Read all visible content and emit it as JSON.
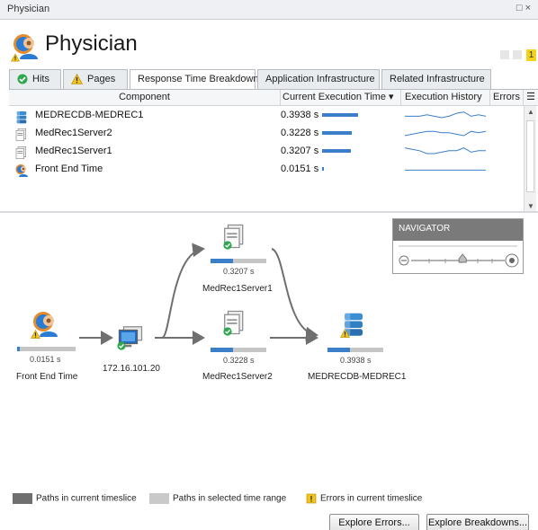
{
  "window": {
    "title": "Physician",
    "restore_icon": "restore-icon",
    "close_icon": "close-icon",
    "controls": "□ ×"
  },
  "header": {
    "title": "Physician",
    "icon": "physician-icon",
    "alert_count": "1"
  },
  "tabs": [
    {
      "label": "Hits",
      "icon": "check-circle-icon"
    },
    {
      "label": "Pages",
      "icon": "warning-icon"
    },
    {
      "label": "Response Time Breakdown",
      "active": true
    },
    {
      "label": "Application Infrastructure"
    },
    {
      "label": "Related Infrastructure"
    }
  ],
  "grid": {
    "columns": {
      "component": "Component",
      "current_execution_time": "Current Execution Time",
      "sort_indicator": "▾",
      "execution_history": "Execution History",
      "errors": "Errors"
    },
    "rows": [
      {
        "name": "MEDRECDB-MEDREC1",
        "time": "0.3938 s",
        "icon": "database-server-icon",
        "bar_fraction": 1.0,
        "history": [
          6,
          6,
          6,
          7,
          6,
          5,
          6,
          8,
          9,
          6,
          7,
          6
        ]
      },
      {
        "name": "MedRec1Server2",
        "time": "0.3228 s",
        "icon": "app-server-icon",
        "bar_fraction": 0.82,
        "history": [
          5,
          6,
          7,
          8,
          8,
          7,
          7,
          6,
          5,
          8,
          7,
          8
        ]
      },
      {
        "name": "MedRec1Server1",
        "time": "0.3207 s",
        "icon": "app-server-icon",
        "bar_fraction": 0.81,
        "history": [
          9,
          8,
          7,
          5,
          5,
          6,
          7,
          7,
          9,
          6,
          7,
          7
        ]
      },
      {
        "name": "Front End Time",
        "time": "0.0151 s",
        "icon": "physician-icon",
        "bar_fraction": 0.04,
        "history": [
          6,
          6,
          6,
          6,
          6,
          6,
          6,
          6,
          6,
          6,
          6,
          6
        ]
      }
    ]
  },
  "flow": {
    "nodes": {
      "front_end": {
        "label": "Front End Time",
        "time": "0.0151 s",
        "icon": "physician-icon",
        "fill_fraction": 0.04
      },
      "gateway": {
        "label": "172.16.101.20",
        "icon": "monitor-icon"
      },
      "server1": {
        "label": "MedRec1Server1",
        "time": "0.3207 s",
        "icon": "app-server-icon",
        "fill_fraction": 0.4
      },
      "server2": {
        "label": "MedRec1Server2",
        "time": "0.3228 s",
        "icon": "app-server-icon",
        "fill_fraction": 0.4
      },
      "database": {
        "label": "MEDRECDB-MEDREC1",
        "time": "0.3938 s",
        "icon": "database-server-icon",
        "fill_fraction": 0.4
      }
    }
  },
  "navigator": {
    "title": "NAVIGATOR",
    "zoom_level": 0.55
  },
  "legend": {
    "current": {
      "label": "Paths in current timeslice",
      "color": "#6f6f6f"
    },
    "selected": {
      "label": "Paths in selected time range",
      "color": "#c9c9c9"
    },
    "errors": {
      "label": "Errors in current timeslice",
      "color": "#f0c419"
    }
  },
  "buttons": {
    "explore_errors": "Explore Errors...",
    "explore_breakdowns": "Explore Breakdowns..."
  },
  "colors": {
    "accent": "#3c7fc9",
    "warning": "#f0c419",
    "ok": "#2fa84f"
  }
}
